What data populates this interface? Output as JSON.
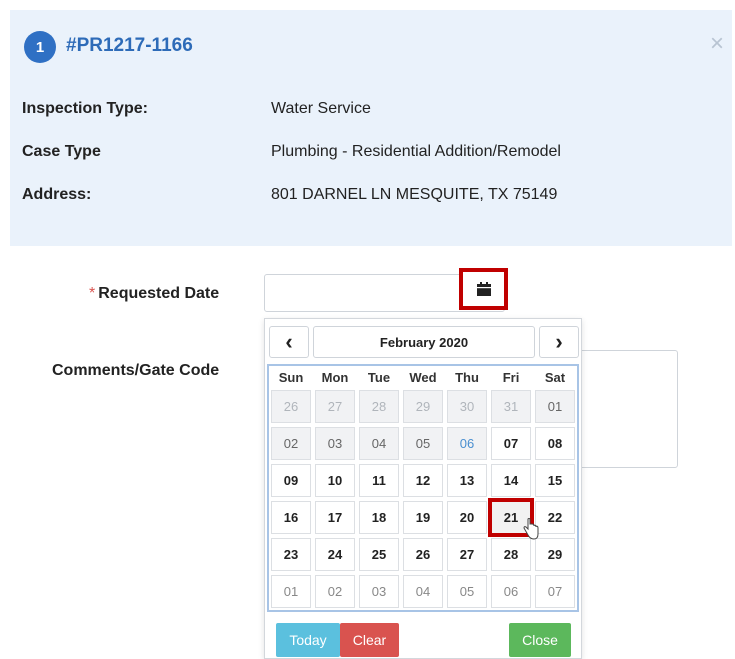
{
  "header": {
    "step": "1",
    "case_id": "#PR1217-1166",
    "close_symbol": "×",
    "rows": [
      {
        "label": "Inspection Type:",
        "value": "Water Service"
      },
      {
        "label": "Case Type",
        "value": "Plumbing - Residential Addition/Remodel"
      },
      {
        "label": "Address:",
        "value": "801 DARNEL LN MESQUITE, TX 75149"
      }
    ]
  },
  "form": {
    "required_marker": "*",
    "requested_date_label": "Requested Date",
    "requested_date_value": "",
    "comments_label": "Comments/Gate Code"
  },
  "datepicker": {
    "prev": "‹",
    "next": "›",
    "month_label": "February 2020",
    "weekdays": [
      "Sun",
      "Mon",
      "Tue",
      "Wed",
      "Thu",
      "Fri",
      "Sat"
    ],
    "weeks": [
      [
        {
          "d": "26",
          "s": "dim"
        },
        {
          "d": "27",
          "s": "dim"
        },
        {
          "d": "28",
          "s": "dim"
        },
        {
          "d": "29",
          "s": "dim"
        },
        {
          "d": "30",
          "s": "dim"
        },
        {
          "d": "31",
          "s": "dim"
        },
        {
          "d": "01",
          "s": "dis"
        }
      ],
      [
        {
          "d": "02",
          "s": "dis"
        },
        {
          "d": "03",
          "s": "dis"
        },
        {
          "d": "04",
          "s": "dis"
        },
        {
          "d": "05",
          "s": "dis"
        },
        {
          "d": "06",
          "s": "today"
        },
        {
          "d": "07",
          "s": ""
        },
        {
          "d": "08",
          "s": ""
        }
      ],
      [
        {
          "d": "09",
          "s": ""
        },
        {
          "d": "10",
          "s": ""
        },
        {
          "d": "11",
          "s": ""
        },
        {
          "d": "12",
          "s": ""
        },
        {
          "d": "13",
          "s": ""
        },
        {
          "d": "14",
          "s": ""
        },
        {
          "d": "15",
          "s": ""
        }
      ],
      [
        {
          "d": "16",
          "s": ""
        },
        {
          "d": "17",
          "s": ""
        },
        {
          "d": "18",
          "s": ""
        },
        {
          "d": "19",
          "s": ""
        },
        {
          "d": "20",
          "s": ""
        },
        {
          "d": "21",
          "s": "sel"
        },
        {
          "d": "22",
          "s": ""
        }
      ],
      [
        {
          "d": "23",
          "s": ""
        },
        {
          "d": "24",
          "s": ""
        },
        {
          "d": "25",
          "s": ""
        },
        {
          "d": "26",
          "s": ""
        },
        {
          "d": "27",
          "s": ""
        },
        {
          "d": "28",
          "s": ""
        },
        {
          "d": "29",
          "s": ""
        }
      ],
      [
        {
          "d": "01",
          "s": "next"
        },
        {
          "d": "02",
          "s": "next"
        },
        {
          "d": "03",
          "s": "next"
        },
        {
          "d": "04",
          "s": "next"
        },
        {
          "d": "05",
          "s": "next"
        },
        {
          "d": "06",
          "s": "next"
        },
        {
          "d": "07",
          "s": "next"
        }
      ]
    ],
    "today_label": "Today",
    "clear_label": "Clear",
    "close_label": "Close"
  },
  "colors": {
    "header_bg": "#eaf2fb",
    "accent_blue": "#2f70c4",
    "highlight_red": "#c00000",
    "today_btn": "#5bc0de",
    "clear_btn": "#d9534f",
    "close_btn": "#5cb85c"
  },
  "icons": {
    "calendar": "calendar-icon",
    "close": "close-icon",
    "prev": "chevron-left-icon",
    "next": "chevron-right-icon",
    "cursor": "hand-cursor-icon"
  }
}
